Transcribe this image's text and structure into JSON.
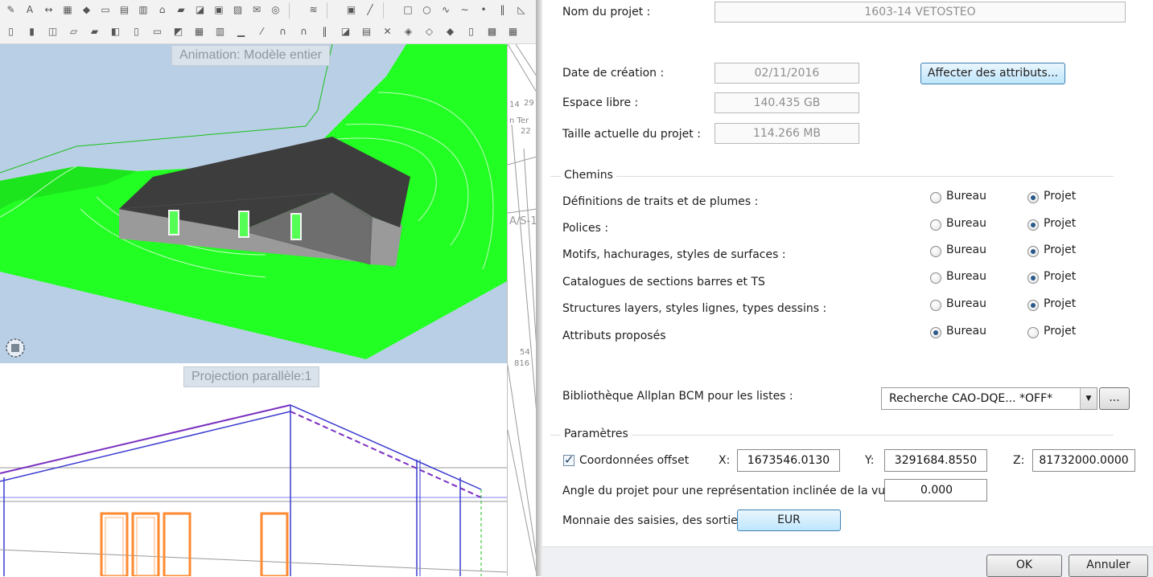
{
  "viewports": {
    "animation_label": "Animation: Modèle entier",
    "projection_label": "Projection parallèle:1"
  },
  "plan_texts": [
    "14",
    "29",
    "n Ter",
    "22",
    "A/S-1",
    "54",
    "816"
  ],
  "dialog": {
    "project_name_label": "Nom du projet :",
    "project_name_value": "1603-14 VETOSTEO",
    "creation_date_label": "Date de création :",
    "creation_date_value": "02/11/2016",
    "assign_attributes_button": "Affecter des attributs...",
    "free_space_label": "Espace libre :",
    "free_space_value": "140.435 GB",
    "project_size_label": "Taille actuelle du projet :",
    "project_size_value": "114.266 MB",
    "paths_group": {
      "title": "Chemins",
      "option_office": "Bureau",
      "option_project": "Projet",
      "rows": [
        {
          "label": "Définitions de traits et de plumes :",
          "selected": "Projet"
        },
        {
          "label": "Polices :",
          "selected": "Projet"
        },
        {
          "label": "Motifs, hachurages, styles de surfaces :",
          "selected": "Projet"
        },
        {
          "label": "Catalogues de sections barres et TS",
          "selected": "Projet"
        },
        {
          "label": "Structures layers, styles lignes, types dessins :",
          "selected": "Projet"
        },
        {
          "label": "Attributs proposés",
          "selected": "Bureau"
        }
      ]
    },
    "bcm_label": "Bibliothèque Allplan BCM pour les listes :",
    "bcm_value": "Recherche CAO-DQE... *OFF*",
    "bcm_browse_button": "...",
    "params_group": {
      "title": "Paramètres",
      "offset_checkbox_label": "Coordonnées offset",
      "offset_checked": true,
      "x_label": "X:",
      "x_value": "1673546.0130",
      "y_label": "Y:",
      "y_value": "3291684.8550",
      "z_label": "Z:",
      "z_value": "81732000.0000",
      "angle_label": "Angle du projet pour une représentation inclinée de la vue en plan :",
      "angle_value": "0.000",
      "currency_label": "Monnaie des saisies, des sorties :",
      "currency_value": "EUR"
    },
    "ok_button": "OK",
    "cancel_button": "Annuler"
  }
}
